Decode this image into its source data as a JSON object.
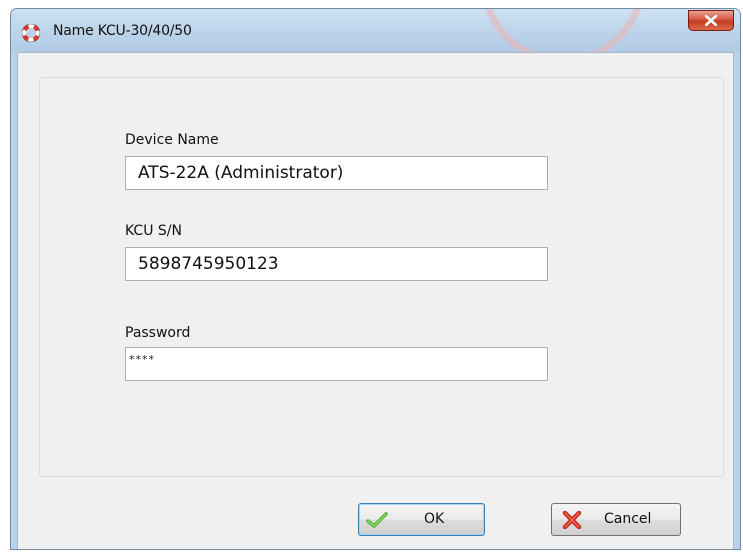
{
  "window": {
    "title": "Name KCU-30/40/50"
  },
  "form": {
    "device_name_label": "Device Name",
    "device_name_value": "ATS-22A (Administrator)",
    "kcu_sn_label": "KCU S/N",
    "kcu_sn_value": "5898745950123",
    "password_label": "Password",
    "password_value": "****"
  },
  "buttons": {
    "ok_label": "OK",
    "cancel_label": "Cancel"
  },
  "icons": {
    "title": "lifebuoy-icon",
    "close": "close-icon",
    "ok": "checkmark-icon",
    "cancel": "red-x-icon"
  },
  "colors": {
    "titlebar": "#bcd3ea",
    "close_button": "#c43b20",
    "client_bg": "#f0f0f0",
    "check_green": "#4caf2a",
    "cancel_red": "#d1281c"
  }
}
